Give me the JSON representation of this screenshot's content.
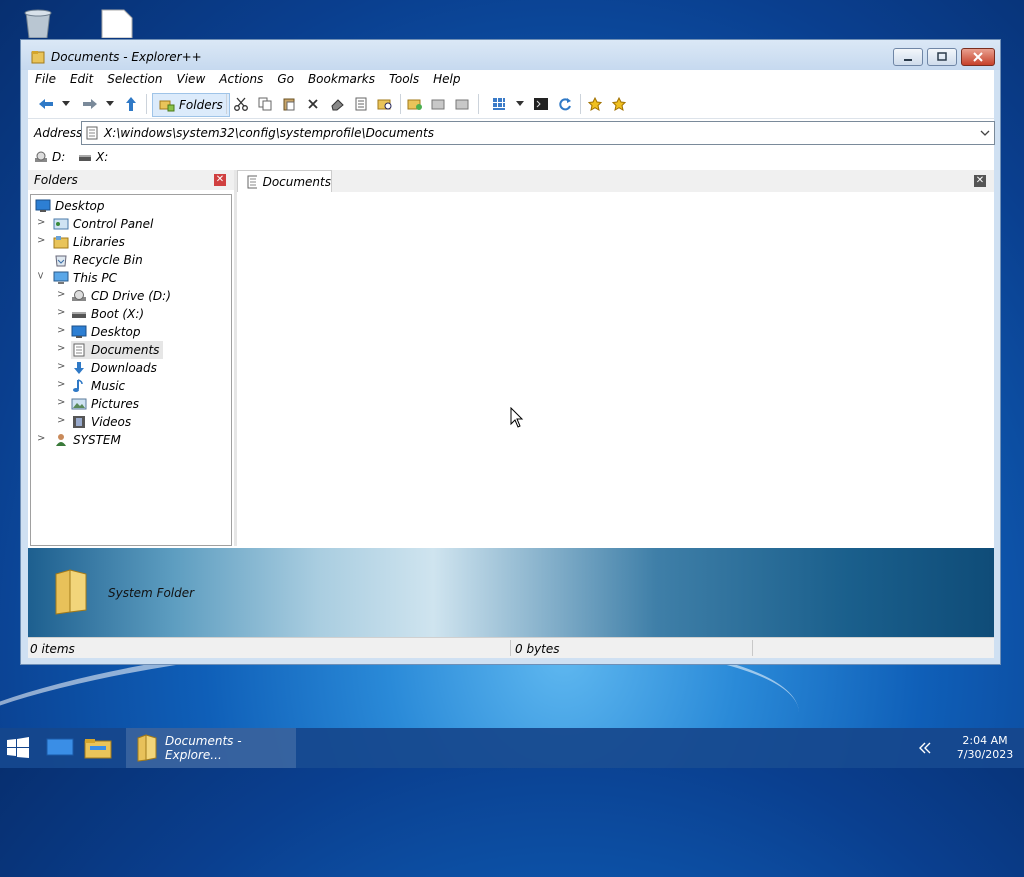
{
  "window": {
    "title": "Documents - Explorer++"
  },
  "menu": [
    "File",
    "Edit",
    "Selection",
    "View",
    "Actions",
    "Go",
    "Bookmarks",
    "Tools",
    "Help"
  ],
  "toolbar": {
    "folders_label": "Folders"
  },
  "address": {
    "label": "Address",
    "value": "X:\\windows\\system32\\config\\systemprofile\\Documents"
  },
  "drives": [
    {
      "label": "D:"
    },
    {
      "label": "X:"
    }
  ],
  "folders_pane": {
    "title": "Folders",
    "tree": [
      {
        "label": "Desktop"
      },
      {
        "label": "Control Panel"
      },
      {
        "label": "Libraries"
      },
      {
        "label": "Recycle Bin"
      },
      {
        "label": "This PC"
      },
      {
        "label": "CD Drive (D:)"
      },
      {
        "label": "Boot (X:)"
      },
      {
        "label": "Desktop"
      },
      {
        "label": "Documents"
      },
      {
        "label": "Downloads"
      },
      {
        "label": "Music"
      },
      {
        "label": "Pictures"
      },
      {
        "label": "Videos"
      },
      {
        "label": "SYSTEM"
      }
    ]
  },
  "tabs": [
    {
      "label": "Documents"
    }
  ],
  "info": {
    "text": "System Folder"
  },
  "status": {
    "items": "0 items",
    "size": "0 bytes"
  },
  "taskbar": {
    "active_label": "Documents - Explore...",
    "time": "2:04 AM",
    "date": "7/30/2023"
  }
}
